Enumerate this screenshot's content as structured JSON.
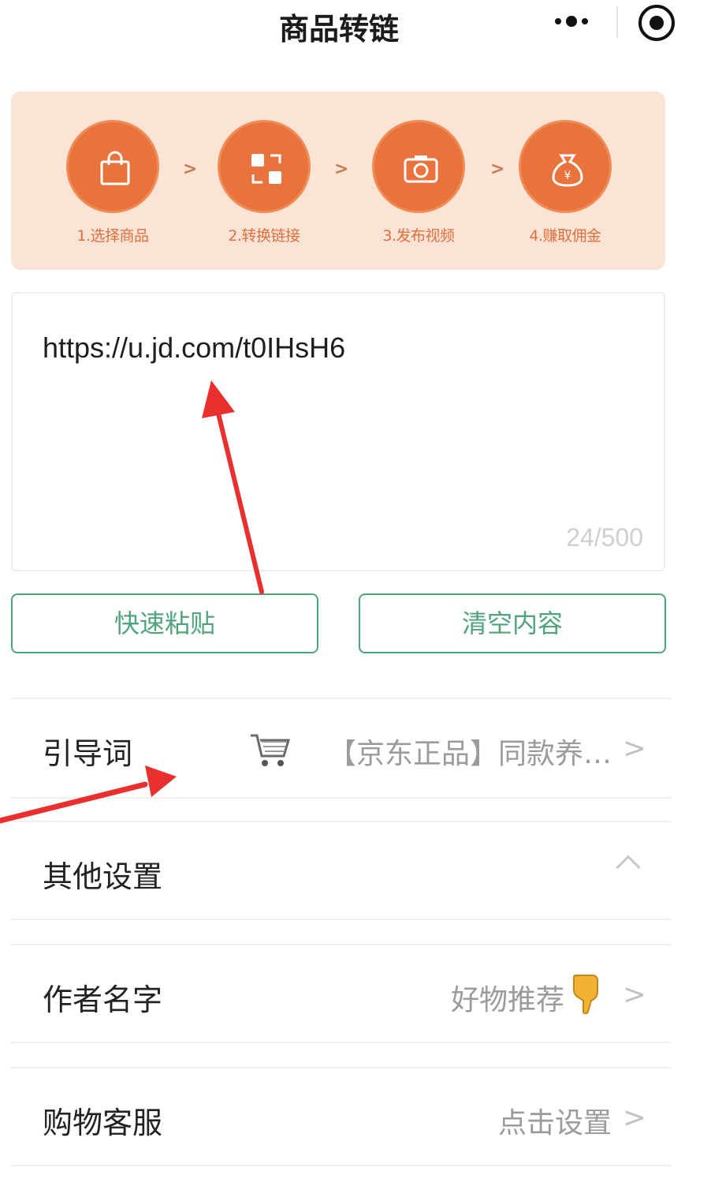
{
  "nav": {
    "title": "商品转链",
    "back_icon": "chevron-left-icon",
    "more_icon": "more-dots-icon",
    "close_icon": "target-circle-icon"
  },
  "steps": [
    {
      "label": "1.选择商品",
      "icon": "shopping-bag-icon"
    },
    {
      "label": "2.转换链接",
      "icon": "convert-icon"
    },
    {
      "label": "3.发布视频",
      "icon": "camera-icon"
    },
    {
      "label": "4.赚取佣金",
      "icon": "money-bag-icon"
    }
  ],
  "step_separator": ">",
  "link_input": {
    "value": "https://u.jd.com/t0IHsH6",
    "count": "24/500"
  },
  "buttons": {
    "paste": "快速粘贴",
    "clear": "清空内容"
  },
  "rows": {
    "guide": {
      "label": "引导词",
      "value": "【京东正品】同款养…",
      "icon": "shopping-cart-icon"
    },
    "other": {
      "label": "其他设置"
    },
    "author": {
      "label": "作者名字",
      "value": "好物推荐",
      "icon": "pointing-down-hand-icon"
    },
    "service": {
      "label": "购物客服",
      "value": "点击设置"
    }
  },
  "chevron": ">",
  "colors": {
    "accent_orange": "#e8733d",
    "banner_bg": "#fbe4d6",
    "button_green": "#4fa37d",
    "annotation_red": "#e8302f"
  }
}
